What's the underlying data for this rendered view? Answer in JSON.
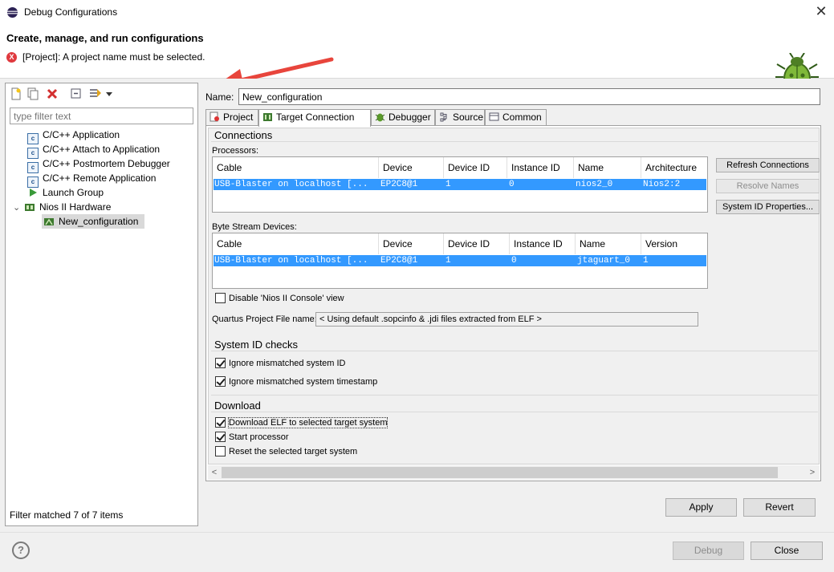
{
  "window": {
    "title": "Debug Configurations",
    "close_glyph": "✕"
  },
  "header": {
    "heading": "Create, manage, and run configurations",
    "error_glyph": "X",
    "error": "[Project]: A project name must be selected."
  },
  "left": {
    "filter_placeholder": "type filter text",
    "tree": [
      {
        "label": "C/C++ Application",
        "icon": "cpp-app-icon"
      },
      {
        "label": "C/C++ Attach to Application",
        "icon": "cpp-app-icon"
      },
      {
        "label": "C/C++ Postmortem Debugger",
        "icon": "cpp-app-icon"
      },
      {
        "label": "C/C++ Remote Application",
        "icon": "cpp-app-icon"
      },
      {
        "label": "Launch Group",
        "icon": "launch-group-icon"
      },
      {
        "label": "Nios II Hardware",
        "icon": "nios-hardware-icon"
      },
      {
        "label": "New_configuration",
        "icon": "nios-config-icon"
      }
    ],
    "cpp_glyph": "c",
    "expander": "⌄",
    "status": "Filter matched 7 of 7 items"
  },
  "config": {
    "name_label": "Name:",
    "name_value": "New_configuration",
    "tabs": [
      "Project",
      "Target Connection",
      "Debugger",
      "Source",
      "Common"
    ],
    "active_tab": "Target Connection"
  },
  "connections": {
    "title": "Connections",
    "processors_label": "Processors:",
    "processors": {
      "headers": [
        "Cable",
        "Device",
        "Device ID",
        "Instance ID",
        "Name",
        "Architecture"
      ],
      "rows": [
        [
          "USB-Blaster on localhost [...",
          "EP2C8@1",
          "1",
          "0",
          "nios2_0",
          "Nios2:2"
        ]
      ]
    },
    "byte_stream_label": "Byte Stream Devices:",
    "byte_stream": {
      "headers": [
        "Cable",
        "Device",
        "Device ID",
        "Instance ID",
        "Name",
        "Version"
      ],
      "rows": [
        [
          "USB-Blaster on localhost [...",
          "EP2C8@1",
          "1",
          "0",
          "jtaguart_0",
          "1"
        ]
      ]
    },
    "buttons": {
      "refresh": "Refresh Connections",
      "resolve": "Resolve Names",
      "sysid": "System ID Properties..."
    },
    "disable_console": {
      "label": "Disable 'Nios II Console' view",
      "checked": false
    },
    "quartus_label": "Quartus Project File name:",
    "quartus_value": "< Using default .sopcinfo & .jdi files extracted from ELF >"
  },
  "sysid": {
    "title": "System ID checks",
    "ignore_id": {
      "label": "Ignore mismatched system ID",
      "checked": true
    },
    "ignore_ts": {
      "label": "Ignore mismatched system timestamp",
      "checked": true
    }
  },
  "download": {
    "title": "Download",
    "elf": {
      "label": "Download ELF to selected target system",
      "checked": true
    },
    "start": {
      "label": "Start processor",
      "checked": true
    },
    "reset": {
      "label": "Reset the selected target system",
      "checked": false
    }
  },
  "scroll": {
    "left": "<",
    "right": ">"
  },
  "footer": {
    "apply": "Apply",
    "revert": "Revert",
    "debug": "Debug",
    "close": "Close",
    "help": "?"
  },
  "colors": {
    "selection": "#3399ff",
    "error": "#e0393e",
    "arrow": "#e8453c"
  }
}
